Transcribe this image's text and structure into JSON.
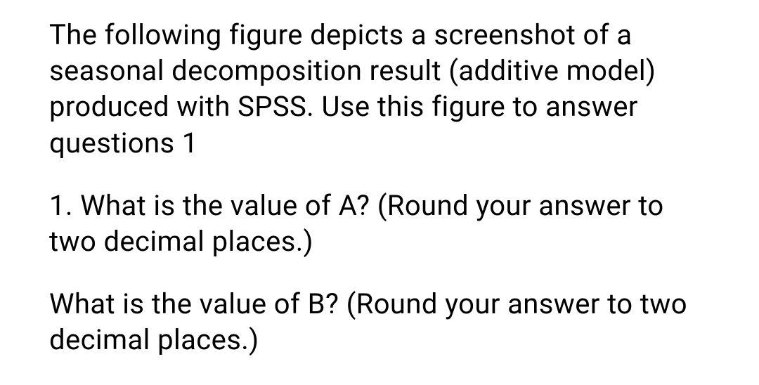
{
  "paragraphs": {
    "intro": "The following figure depicts a screenshot of a seasonal decomposition result (additive model) produced with SPSS. Use this figure to answer questions 1",
    "question1": "1. What is the value of A? (Round your answer to two decimal places.)",
    "question2": "What is the value of B? (Round your answer to two decimal places.)"
  }
}
